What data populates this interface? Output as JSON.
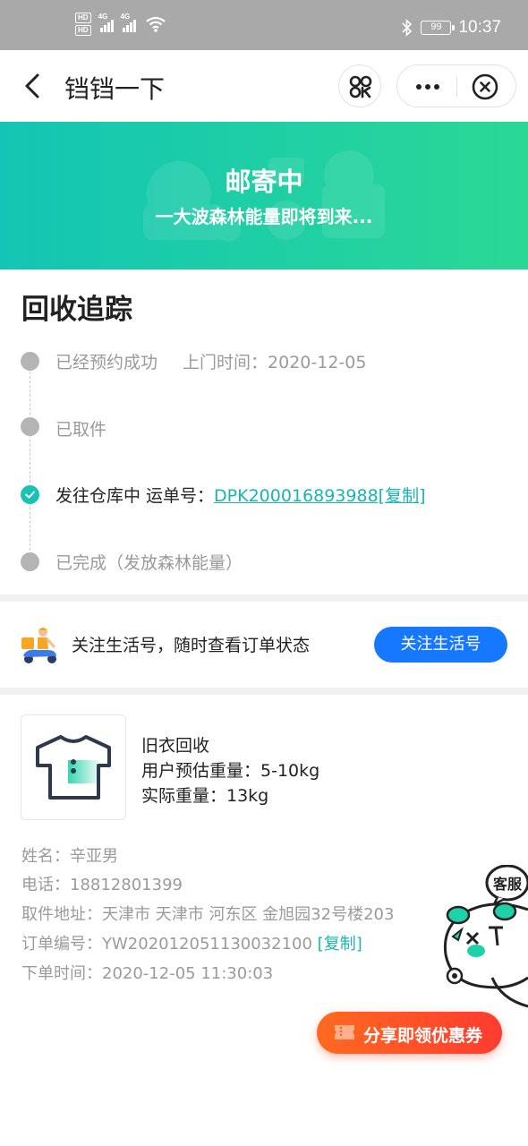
{
  "status_bar": {
    "hd_badges": [
      "HD",
      "HD"
    ],
    "network_1": "4G",
    "network_2": "4G",
    "battery": "99",
    "time": "10:37",
    "icons": [
      "signal-icon",
      "wifi-icon",
      "bluetooth-icon",
      "battery-icon"
    ]
  },
  "nav": {
    "title": "铛铛一下",
    "icons": [
      "back-icon",
      "scan-icon",
      "more-icon",
      "close-icon"
    ]
  },
  "banner": {
    "title": "邮寄中",
    "subtitle": "一大波森林能量即将到来..."
  },
  "tracking": {
    "title": "回收追踪",
    "steps": [
      {
        "label": "已经预约成功",
        "extra": "上门时间：2020-12-05",
        "state": "done"
      },
      {
        "label": "已取件",
        "state": "done"
      },
      {
        "label": "发往仓库中 运单号：",
        "link": "DPK200016893988[复制]",
        "state": "current"
      },
      {
        "label": "已完成（发放森林能量）",
        "state": "pending"
      }
    ]
  },
  "follow": {
    "text": "关注生活号，随时查看订单状态",
    "button": "关注生活号"
  },
  "product": {
    "name": "旧衣回收",
    "estimated_weight": "用户预估重量：5-10kg",
    "actual_weight": "实际重量：13kg"
  },
  "order": {
    "name_line": "姓名：辛亚男",
    "phone_line": "电话：18812801399",
    "address_line": "取件地址：天津市 天津市 河东区 金旭园32号楼203",
    "order_no_line": "订单编号：YW202012051130032100",
    "copy_label": "[复制]",
    "time_line": "下单时间：2020-12-05 11:30:03"
  },
  "customer_service": {
    "label": "客服"
  },
  "share": {
    "label": "分享即领优惠券"
  },
  "colors": {
    "banner_start": "#13c5b4",
    "banner_end": "#2ad895",
    "teal": "#19b5b1",
    "blue_button": "#1677ff",
    "share_start": "#ff6a1f",
    "share_end": "#ff3b30"
  }
}
